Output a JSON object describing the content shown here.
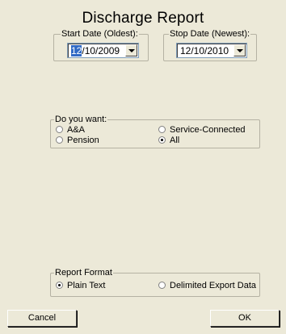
{
  "title": "Discharge Report",
  "start_date": {
    "label": "Start Date (Oldest):",
    "value_selected": "12",
    "value_rest": "/10/2009"
  },
  "stop_date": {
    "label": "Stop Date (Newest):",
    "value": "12/10/2010"
  },
  "want_group": {
    "label": "Do you want:",
    "options": [
      "A&A",
      "Service-Connected",
      "Pension",
      "All"
    ],
    "selected": "All"
  },
  "format_group": {
    "label": "Report Format",
    "options": [
      "Plain Text",
      "Delimited Export Data"
    ],
    "selected": "Plain Text"
  },
  "buttons": {
    "cancel": "Cancel",
    "ok": "OK"
  }
}
